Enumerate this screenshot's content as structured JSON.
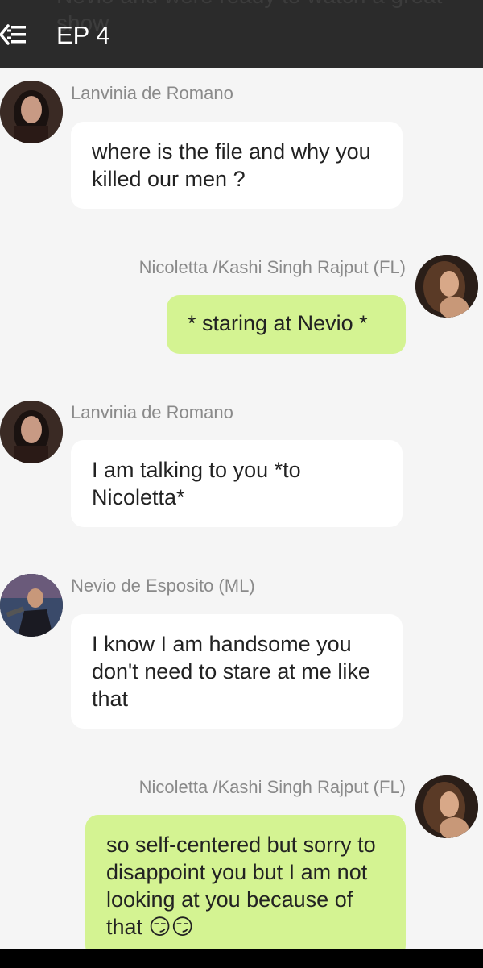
{
  "header": {
    "title": "EP 4",
    "ghost_text": "Nevio and were ready to watch a great show"
  },
  "messages": [
    {
      "sender": "Lanvinia de Romano",
      "text": "where is the file and why you killed our men ?"
    },
    {
      "sender": "Nicoletta /Kashi Singh Rajput (FL)",
      "text": "* staring at Nevio *"
    },
    {
      "sender": "Lanvinia de Romano",
      "text": "I am talking to you *to Nicoletta*"
    },
    {
      "sender": "Nevio de Esposito (ML)",
      "text": "I know I am handsome you don't need to stare at me like that"
    },
    {
      "sender": "Nicoletta /Kashi Singh Rajput (FL)",
      "text": "so self-centered but sorry to disappoint you but I am not looking at you because of that 😏😏"
    }
  ],
  "colors": {
    "header_bg": "#2b2b2b",
    "page_bg": "#f5f5f5",
    "bubble_white": "#ffffff",
    "bubble_green": "#d4f392",
    "sender_text": "#8a8a8a"
  }
}
